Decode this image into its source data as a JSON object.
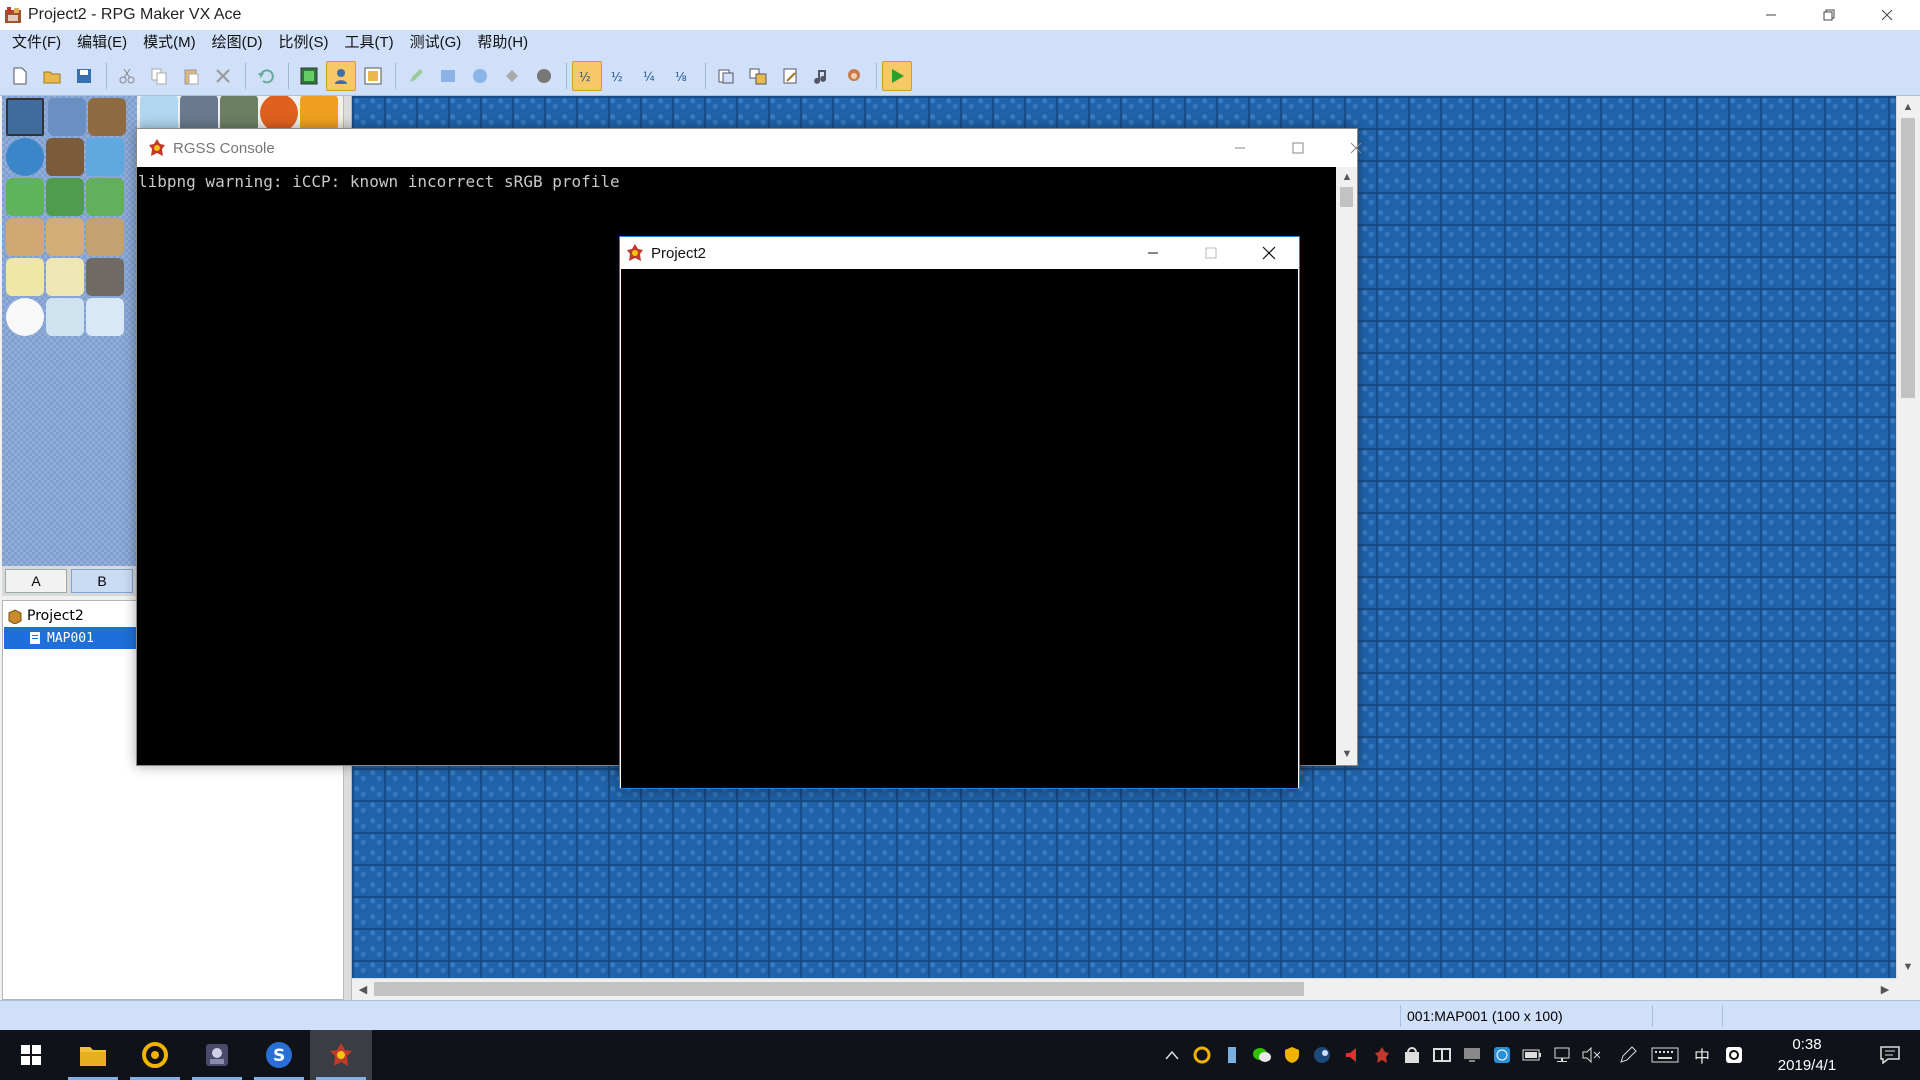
{
  "app": {
    "title": "Project2 - RPG Maker VX Ace"
  },
  "menu": [
    "文件(F)",
    "编辑(E)",
    "模式(M)",
    "绘图(D)",
    "比例(S)",
    "工具(T)",
    "测试(G)",
    "帮助(H)"
  ],
  "toolbar": {
    "icons": [
      "new-project-icon",
      "open-project-icon",
      "save-project-icon",
      "cut-icon",
      "copy-icon",
      "paste-icon",
      "delete-icon",
      "undo-icon",
      "map-layer-icon",
      "event-layer-icon",
      "region-layer-icon",
      "pencil-icon",
      "rectangle-icon",
      "ellipse-icon",
      "flood-fill-icon",
      "shadow-pen-icon",
      "zoom-1-1-icon",
      "zoom-1-2-icon",
      "zoom-1-4-icon",
      "zoom-1-8-icon",
      "database-icon",
      "resource-manager-icon",
      "script-editor-icon",
      "sound-test-icon",
      "character-generator-icon",
      "playtest-icon"
    ],
    "active": [
      "event-layer-icon",
      "zoom-1-1-icon",
      "playtest-icon"
    ]
  },
  "tileset": {
    "tabs": [
      "A",
      "B"
    ],
    "selected_tab": "B"
  },
  "maptree": {
    "project": "Project2",
    "maps": [
      "MAP001"
    ],
    "selected": "MAP001"
  },
  "status": {
    "map_info": "001:MAP001 (100 x 100)"
  },
  "console": {
    "title": "RGSS Console",
    "lines": [
      "libpng warning: iCCP: known incorrect sRGB profile"
    ]
  },
  "game_window": {
    "title": "Project2"
  },
  "taskbar": {
    "apps": [
      "start-icon",
      "file-explorer-icon",
      "browser-icon",
      "game-app-icon",
      "sogou-icon",
      "rpg-maker-icon"
    ],
    "tray_icons": [
      "chevron-up-icon",
      "tray-app-icon",
      "usb-icon",
      "wechat-icon",
      "shield-icon",
      "steam-icon",
      "speaker-red-icon",
      "tray-game-icon",
      "tray-store-icon",
      "tray-media-icon",
      "tray-display-icon",
      "tray-network-globe-icon",
      "battery-icon",
      "network-icon",
      "volume-mute-icon",
      "pen-icon",
      "keyboard-icon"
    ],
    "ime": "中",
    "time": "0:38",
    "date": "2019/4/1"
  }
}
